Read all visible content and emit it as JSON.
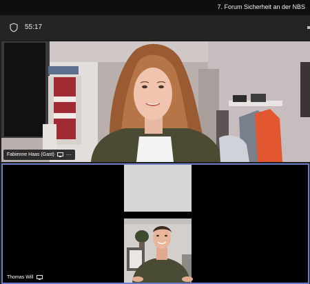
{
  "window": {
    "title": "7. Forum Sicherheit an der NBS"
  },
  "call": {
    "duration": "55:17"
  },
  "participants": [
    {
      "name": "Fabienne Haas (Gast)",
      "more": "···"
    },
    {
      "name": "Thomas Will"
    }
  ],
  "colors": {
    "active_speaker_border": "#6b7cc9",
    "chrome_bg": "#242424",
    "title_bg": "#0e0e0e"
  },
  "icons": [
    "shield-icon",
    "screen-share-icon",
    "more-options-icon"
  ]
}
